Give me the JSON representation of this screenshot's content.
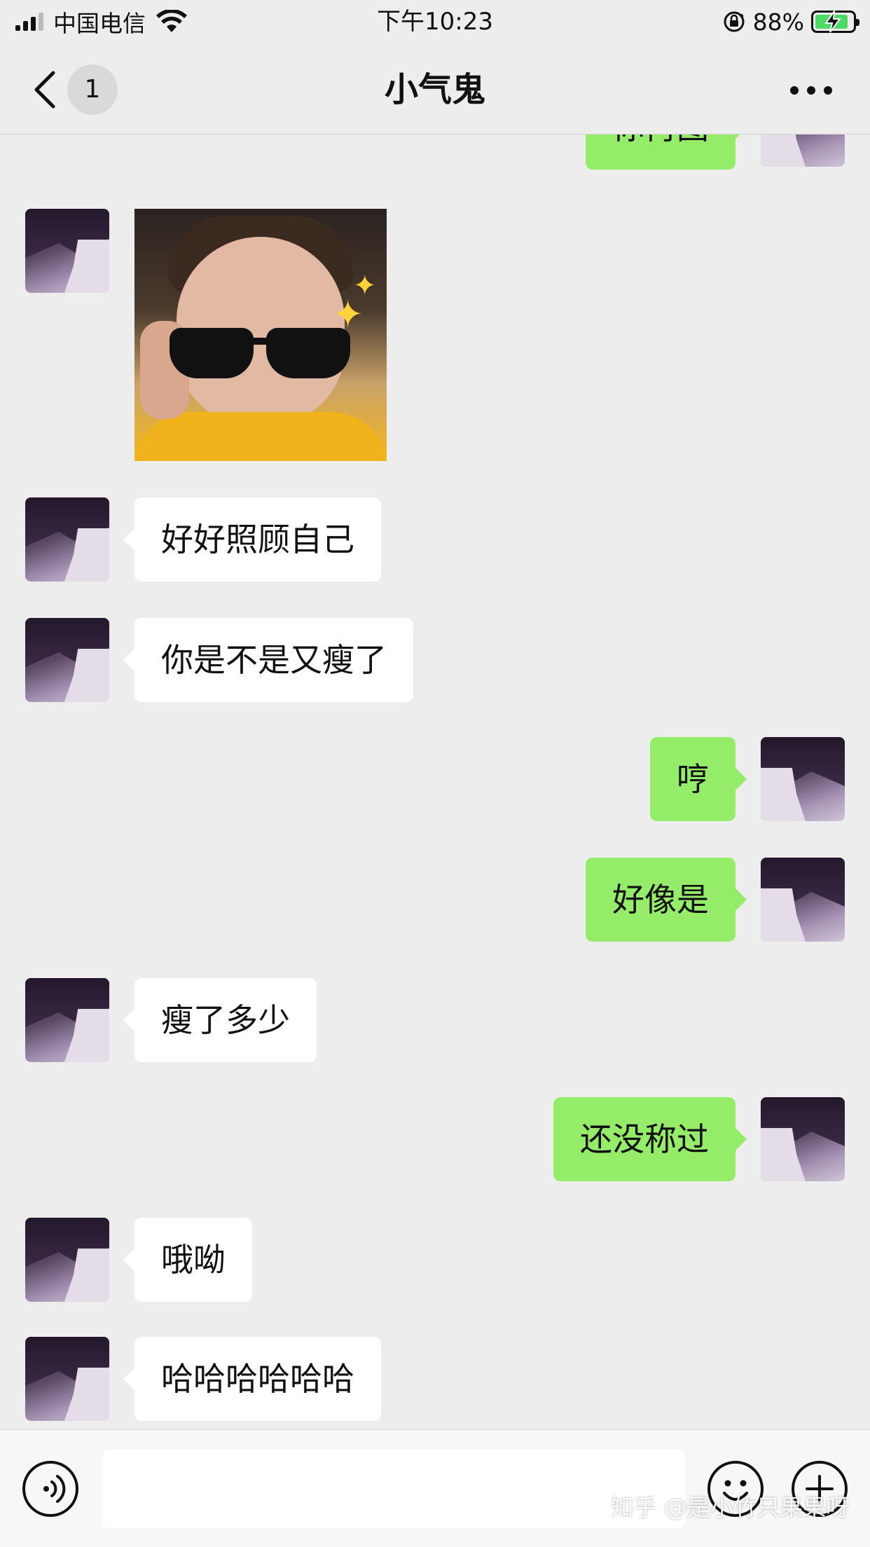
{
  "status_bar": {
    "carrier": "中国电信",
    "time": "下午10:23",
    "battery_percent": "88%",
    "battery_level": 0.88,
    "icons": [
      "signal-icon",
      "wifi-icon",
      "rotation-lock-icon",
      "battery-charging-icon"
    ]
  },
  "nav": {
    "title": "小气鬼",
    "unread_count": "1",
    "icons": [
      "back-chevron-icon",
      "more-icon"
    ]
  },
  "messages": [
    {
      "side": "right",
      "type": "text",
      "text": "你再图",
      "partially_visible": true
    },
    {
      "side": "left",
      "type": "image",
      "description": "photo-sticker"
    },
    {
      "side": "left",
      "type": "text",
      "text": "好好照顾自己"
    },
    {
      "side": "left",
      "type": "text",
      "text": "你是不是又瘦了"
    },
    {
      "side": "right",
      "type": "text",
      "text": "哼"
    },
    {
      "side": "right",
      "type": "text",
      "text": "好像是"
    },
    {
      "side": "left",
      "type": "text",
      "text": "瘦了多少"
    },
    {
      "side": "right",
      "type": "text",
      "text": "还没称过"
    },
    {
      "side": "left",
      "type": "text",
      "text": "哦呦"
    },
    {
      "side": "left",
      "type": "text",
      "text": "哈哈哈哈哈哈"
    }
  ],
  "input_bar": {
    "value": "",
    "icons": [
      "voice-icon",
      "emoji-icon",
      "plus-icon"
    ],
    "watermark": "知乎 @是小竹只果果呀"
  },
  "colors": {
    "background": "#ededed",
    "sent_bubble": "#95ec69",
    "received_bubble": "#ffffff",
    "battery_green": "#4cd964"
  }
}
